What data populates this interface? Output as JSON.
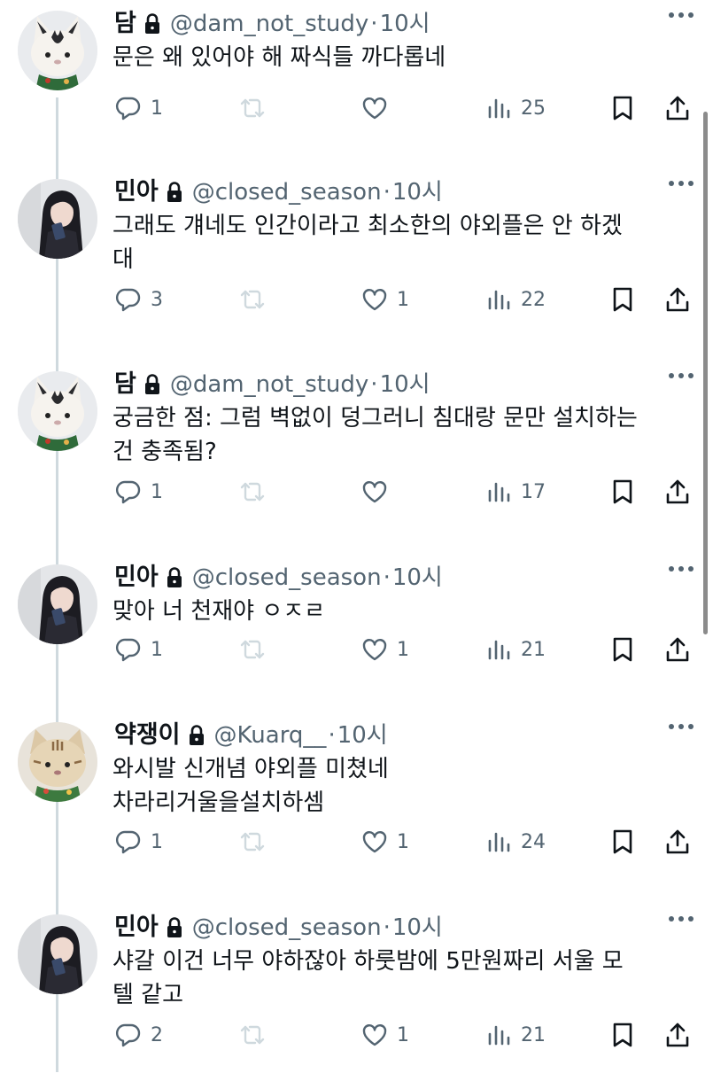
{
  "tweets": [
    {
      "name": "담",
      "handle": "@dam_not_study",
      "dot": "·",
      "time": "10시",
      "text": "문은 왜 있어야 해 짜식들 까다롭네",
      "avatar": "cat-plush-avatar",
      "stats": {
        "replies": "1",
        "retweets": "",
        "likes": "",
        "views": "25"
      }
    },
    {
      "name": "민아",
      "handle": "@closed_season",
      "dot": "·",
      "time": "10시",
      "text": "그래도 걔네도 인간이라고 최소한의 야외플은 안 하겠\n대",
      "avatar": "girl-photo-avatar",
      "stats": {
        "replies": "3",
        "retweets": "",
        "likes": "1",
        "views": "22"
      }
    },
    {
      "name": "담",
      "handle": "@dam_not_study",
      "dot": "·",
      "time": "10시",
      "text": "궁금한 점: 그럼 벽없이 덩그러니 침대랑 문만 설치하는\n건 충족됨?",
      "avatar": "cat-plush-avatar",
      "stats": {
        "replies": "1",
        "retweets": "",
        "likes": "",
        "views": "17"
      }
    },
    {
      "name": "민아",
      "handle": "@closed_season",
      "dot": "·",
      "time": "10시",
      "text": "맞아 너 천재야 ㅇㅈㄹ",
      "avatar": "girl-photo-avatar",
      "stats": {
        "replies": "1",
        "retweets": "",
        "likes": "1",
        "views": "21"
      }
    },
    {
      "name": "약쟁이",
      "handle": "@Kuarq__",
      "dot": "·",
      "time": "10시",
      "text": "와시발 신개념 야외플 미쳤네\n차라리거울을설치하셈",
      "avatar": "tabby-plush-avatar",
      "stats": {
        "replies": "1",
        "retweets": "",
        "likes": "1",
        "views": "24"
      }
    },
    {
      "name": "민아",
      "handle": "@closed_season",
      "dot": "·",
      "time": "10시",
      "text": "샤갈 이건 너무 야하잖아 하룻밤에 5만원짜리 서울 모\n텔 같고",
      "avatar": "girl-photo-avatar",
      "stats": {
        "replies": "2",
        "retweets": "",
        "likes": "1",
        "views": "21"
      }
    }
  ],
  "colors": {
    "text": "#0f1419",
    "muted": "#536471",
    "thread": "#cfd9de",
    "retweet_inactive": "#cfd9de"
  }
}
